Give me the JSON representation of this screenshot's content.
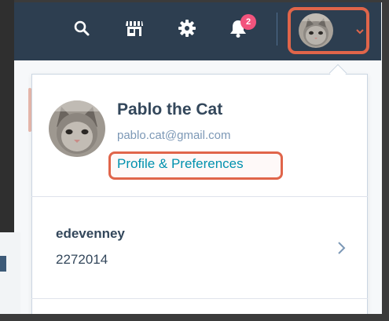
{
  "nav": {
    "icons": [
      "search-icon",
      "marketplace-icon",
      "settings-gear-icon",
      "notifications-bell-icon"
    ],
    "notification_count": "2",
    "accent_color": "#e0654a",
    "badge_color": "#f2547d",
    "bar_color": "#2d3e50"
  },
  "user": {
    "name": "Pablo the Cat",
    "email": "pablo.cat@gmail.com",
    "profile_link": "Profile & Preferences"
  },
  "account": {
    "name": "edevenney",
    "id": "2272014"
  }
}
